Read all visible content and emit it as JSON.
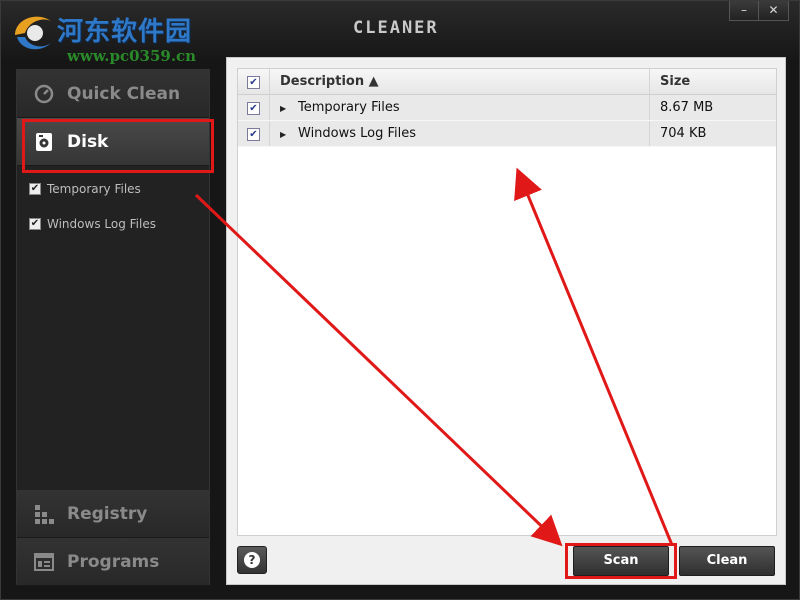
{
  "window": {
    "title": "CLEANER",
    "controls": {
      "minimize": "–",
      "close": "✕"
    }
  },
  "watermark": {
    "site_name": "河东软件园",
    "url": "www.pc0359.cn"
  },
  "sidebar": {
    "nav": [
      {
        "label": "Quick Clean",
        "icon": "gauge-icon",
        "active": false
      },
      {
        "label": "Disk",
        "icon": "disk-icon",
        "active": true
      },
      {
        "label": "Registry",
        "icon": "registry-icon",
        "active": false
      },
      {
        "label": "Programs",
        "icon": "programs-icon",
        "active": false
      }
    ],
    "disk_items": [
      {
        "label": "Temporary Files",
        "checked": true
      },
      {
        "label": "Windows Log Files",
        "checked": true
      }
    ]
  },
  "list": {
    "columns": {
      "description": "Description ▲",
      "size": "Size"
    },
    "rows": [
      {
        "description": "Temporary Files",
        "size": "8.67 MB",
        "checked": true
      },
      {
        "description": "Windows Log Files",
        "size": "704 KB",
        "checked": true
      }
    ]
  },
  "buttons": {
    "help": "?",
    "scan": "Scan",
    "clean": "Clean"
  },
  "colors": {
    "annotation": "#e01818",
    "accent_blue": "#2f78c8"
  }
}
